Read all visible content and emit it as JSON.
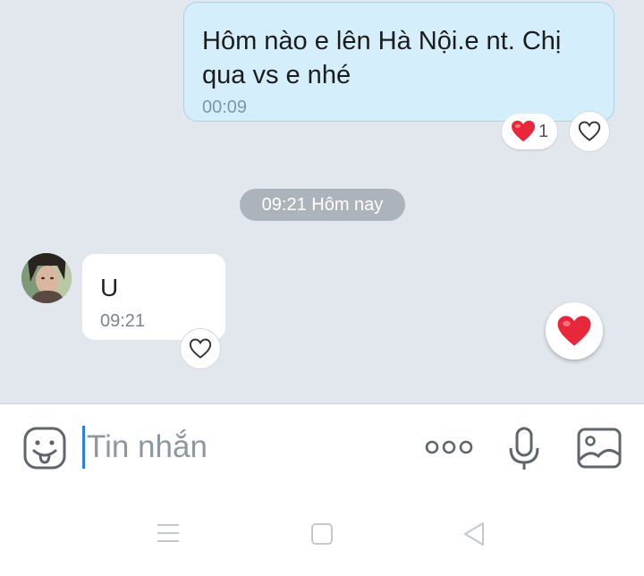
{
  "messages": {
    "outgoing": {
      "text": "Hôm nào e lên Hà Nội.e nt. Chị qua vs e nhé",
      "time": "00:09",
      "reaction_count": "1"
    },
    "separator": "09:21 Hôm nay",
    "incoming": {
      "text": "U",
      "time": "09:21"
    }
  },
  "composer": {
    "placeholder": "Tin nhắn"
  },
  "colors": {
    "accent": "#2b7de9",
    "heart": "#e8283a",
    "bubble_out": "#d5eefc"
  },
  "icons": [
    "heart-icon",
    "sticker-icon",
    "more-icon",
    "mic-icon",
    "image-icon",
    "menu-icon",
    "home-icon",
    "back-icon"
  ]
}
